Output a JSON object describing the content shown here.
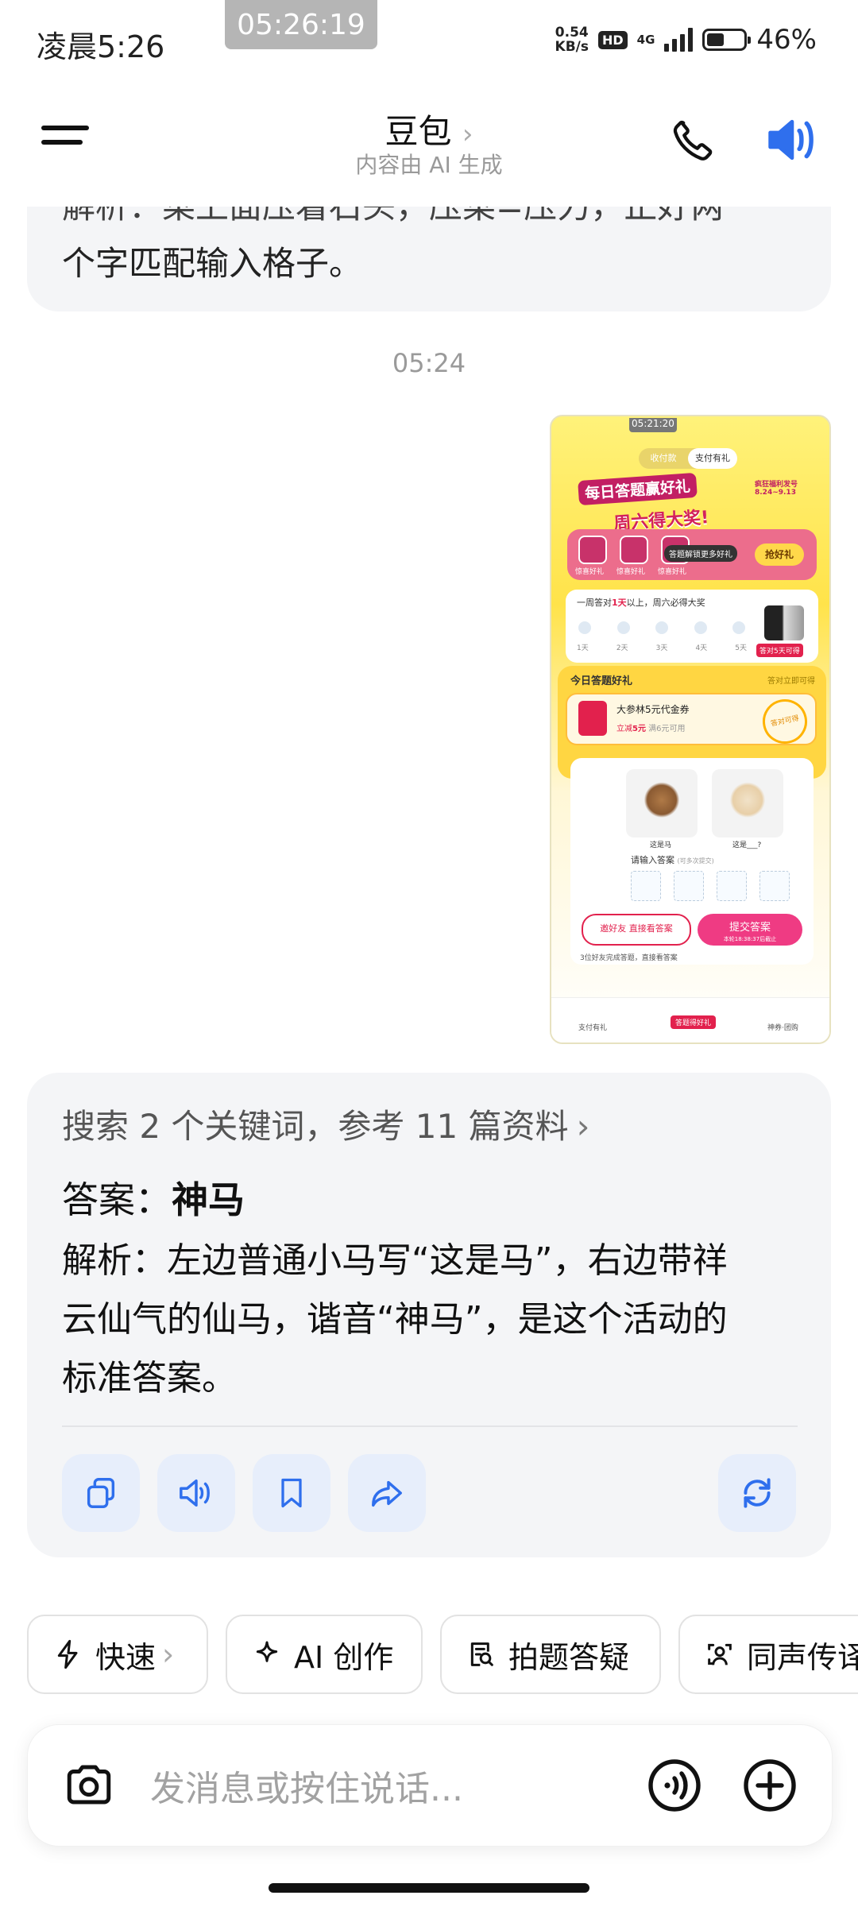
{
  "status_bar": {
    "time": "凌晨5:26",
    "recording_time": "05:26:19",
    "net_speed_value": "0.54",
    "net_speed_unit": "KB/s",
    "hd": "HD",
    "network": "4G",
    "battery": "46%",
    "battery_level": 0.46
  },
  "header": {
    "title": "豆包",
    "chevron": "›",
    "subtitle": "内容由 AI 生成",
    "icons": [
      "menu-icon",
      "phone-icon",
      "speaker-icon"
    ]
  },
  "chat": {
    "prev_message_line1": "解析：菜上面压着石头，压菜=压力，正好两",
    "prev_message_line2": "个字匹配输入格子。",
    "timestamp": "05:24",
    "screenshot": {
      "time": "05:21:20",
      "tab_left": "收付款",
      "tab_right": "支付有礼",
      "banner_line1": "每日答题赢好礼",
      "banner_line2": "周六得大奖!",
      "banner_note": "疯狂福利发号",
      "date_range": "8.24~9.13",
      "gift1": "惊喜好礼",
      "gift2": "惊喜好礼",
      "gift3": "惊喜好礼",
      "lock_text": "答题解锁更多好礼",
      "grab_button": "抢好礼",
      "week_text_pre": "一周答对",
      "week_text_days": "1天",
      "week_text_post": "以上，周六必得大奖",
      "days": [
        "1天",
        "2天",
        "3天",
        "4天",
        "5天"
      ],
      "week_ribbon": "答对5天可得",
      "section_title": "今日答题好礼",
      "section_right": "答对立即可得",
      "coupon_title": "大参林5元代金券",
      "coupon_sub_pre": "立减",
      "coupon_sub_amount": "5元",
      "coupon_sub_post": "满6元可用",
      "coupon_stamp": "答对可得",
      "redeem_label": "换奖品",
      "caption1": "这是马",
      "caption2": "这是___?",
      "input_label": "请输入答案",
      "input_hint": "(可多次提交)",
      "invite_button": "邀好友 直接看答案",
      "submit_button": "提交答案",
      "submit_sub": "本轮18:38:37后截止",
      "footer_text": "3位好友完成答题，直接看答案",
      "nav1": "支付有礼",
      "nav1_badge": "领取奖励",
      "nav2": "答题得好礼",
      "nav3": "神券·团购"
    }
  },
  "answer_card": {
    "search_summary": "搜索 2 个关键词，参考 11 篇资料",
    "chevron": "›",
    "answer_label": "答案：",
    "answer_value": "神马",
    "explain_line1": "解析：左边普通小马写“这是马”，右边带祥",
    "explain_line2": "云仙气的仙马，谐音“神马”，是这个活动的",
    "explain_line3": "标准答案。",
    "actions": [
      "copy-icon",
      "read-aloud-icon",
      "bookmark-icon",
      "share-icon",
      "regenerate-icon"
    ]
  },
  "chips": [
    {
      "label": "快速",
      "suffix": "›"
    },
    {
      "label": "AI 创作"
    },
    {
      "label": "拍题答疑"
    },
    {
      "label": "同声传译"
    }
  ],
  "input": {
    "placeholder": "发消息或按住说话..."
  }
}
